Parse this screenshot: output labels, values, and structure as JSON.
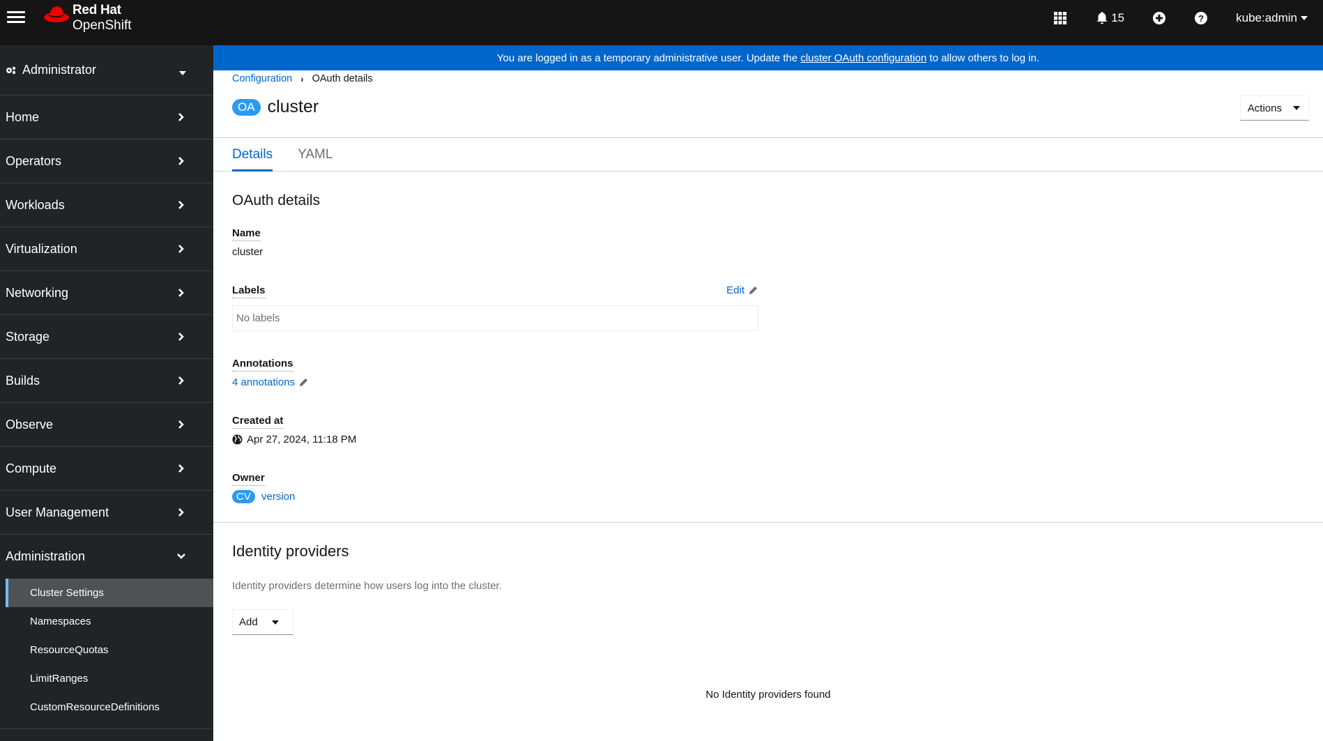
{
  "masthead": {
    "brand": "Red Hat",
    "product": "OpenShift",
    "notifications_count": "15",
    "user": "kube:admin",
    "icons": [
      "hamburger-icon",
      "app-launcher-icon",
      "bell-icon",
      "plus-circle-icon",
      "help-icon"
    ]
  },
  "sidebar": {
    "perspective": "Administrator",
    "items": [
      {
        "label": "Home"
      },
      {
        "label": "Operators"
      },
      {
        "label": "Workloads"
      },
      {
        "label": "Virtualization"
      },
      {
        "label": "Networking"
      },
      {
        "label": "Storage"
      },
      {
        "label": "Builds"
      },
      {
        "label": "Observe"
      },
      {
        "label": "Compute"
      },
      {
        "label": "User Management"
      },
      {
        "label": "Administration",
        "expanded": true
      }
    ],
    "subitems": [
      {
        "label": "Cluster Settings",
        "active": true
      },
      {
        "label": "Namespaces"
      },
      {
        "label": "ResourceQuotas"
      },
      {
        "label": "LimitRanges"
      },
      {
        "label": "CustomResourceDefinitions"
      }
    ]
  },
  "banner": {
    "text_before": "You are logged in as a temporary administrative user. Update the ",
    "link": "cluster OAuth configuration",
    "text_after": " to allow others to log in."
  },
  "breadcrumb": {
    "parent": "Configuration",
    "current": "OAuth details"
  },
  "header": {
    "badge": "OA",
    "title": "cluster",
    "actions_label": "Actions"
  },
  "tabs": [
    {
      "label": "Details",
      "active": true
    },
    {
      "label": "YAML"
    }
  ],
  "details": {
    "heading": "OAuth details",
    "name_label": "Name",
    "name_value": "cluster",
    "labels_label": "Labels",
    "edit_label": "Edit",
    "labels_empty": "No labels",
    "annotations_label": "Annotations",
    "annotations_value": "4 annotations",
    "created_label": "Created at",
    "created_value": "Apr 27, 2024, 11:18 PM",
    "owner_label": "Owner",
    "owner_badge": "CV",
    "owner_value": "version"
  },
  "identity_providers": {
    "heading": "Identity providers",
    "description": "Identity providers determine how users log into the cluster.",
    "add_label": "Add",
    "empty_text": "No Identity providers found"
  },
  "colors": {
    "accent": "#0066cc",
    "masthead": "#151515",
    "sidebar": "#212427",
    "badge": "#2b9af3",
    "brand_red": "#ee0000"
  }
}
